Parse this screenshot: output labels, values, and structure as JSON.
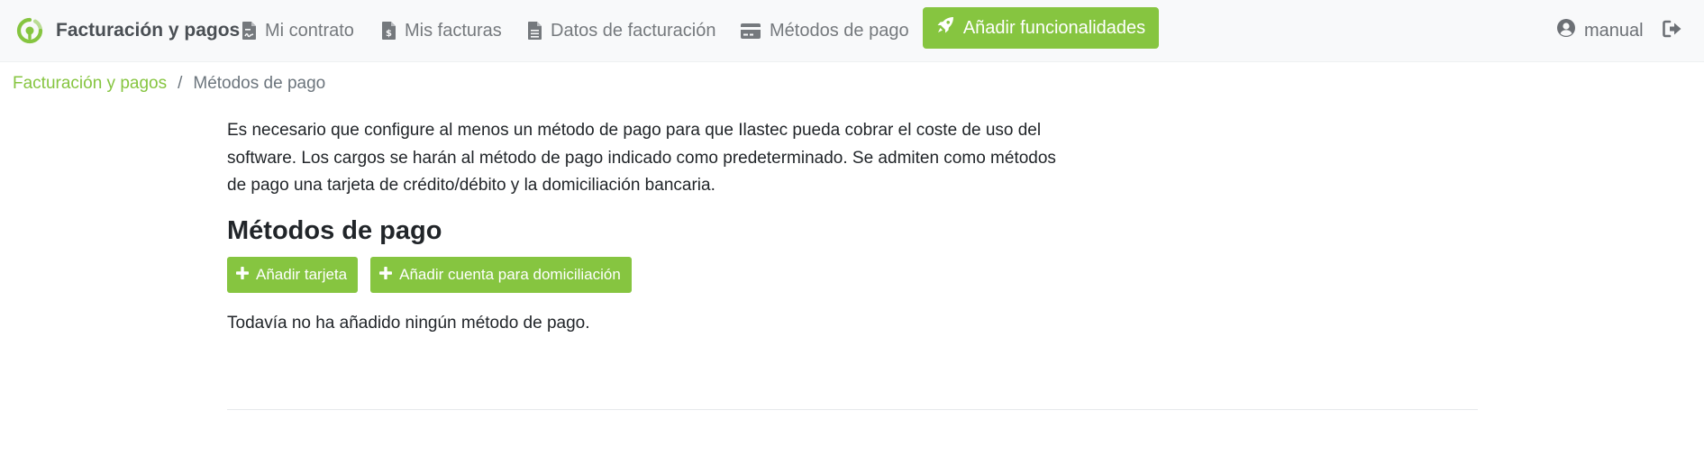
{
  "navbar": {
    "brand": {
      "icon": "billing-logo-icon",
      "label": "Facturación y pagos"
    },
    "links": [
      {
        "icon": "file-contract-icon",
        "label": "Mi contrato"
      },
      {
        "icon": "file-invoice-dollar-icon",
        "label": "Mis facturas"
      },
      {
        "icon": "file-alt-icon",
        "label": "Datos de facturación"
      },
      {
        "icon": "credit-card-icon",
        "label": "Métodos de pago"
      }
    ],
    "cta": {
      "icon": "rocket-icon",
      "label": "Añadir funcionalidades"
    },
    "user": {
      "icon": "user-circle-icon",
      "label": "manual"
    },
    "logout": {
      "icon": "sign-out-icon"
    }
  },
  "breadcrumb": {
    "parent": "Facturación y pagos",
    "separator": "/",
    "current": "Métodos de pago"
  },
  "main": {
    "intro": "Es necesario que configure al menos un método de pago para que Ilastec pueda cobrar el coste de uso del software. Los cargos se harán al método de pago indicado como predeterminado. Se admiten como métodos de pago una tarjeta de crédito/débito y la domiciliación bancaria.",
    "title": "Métodos de pago",
    "buttons": {
      "add_card": {
        "icon": "plus-icon",
        "label": "Añadir tarjeta"
      },
      "add_account": {
        "icon": "plus-icon",
        "label": "Añadir cuenta para domiciliación"
      }
    },
    "empty_message": "Todavía no ha añadido ningún método de pago."
  },
  "colors": {
    "accent": "#86c540",
    "navbar_bg": "#f8f9fa",
    "nav_text": "#75797d",
    "body_text": "#212529"
  }
}
